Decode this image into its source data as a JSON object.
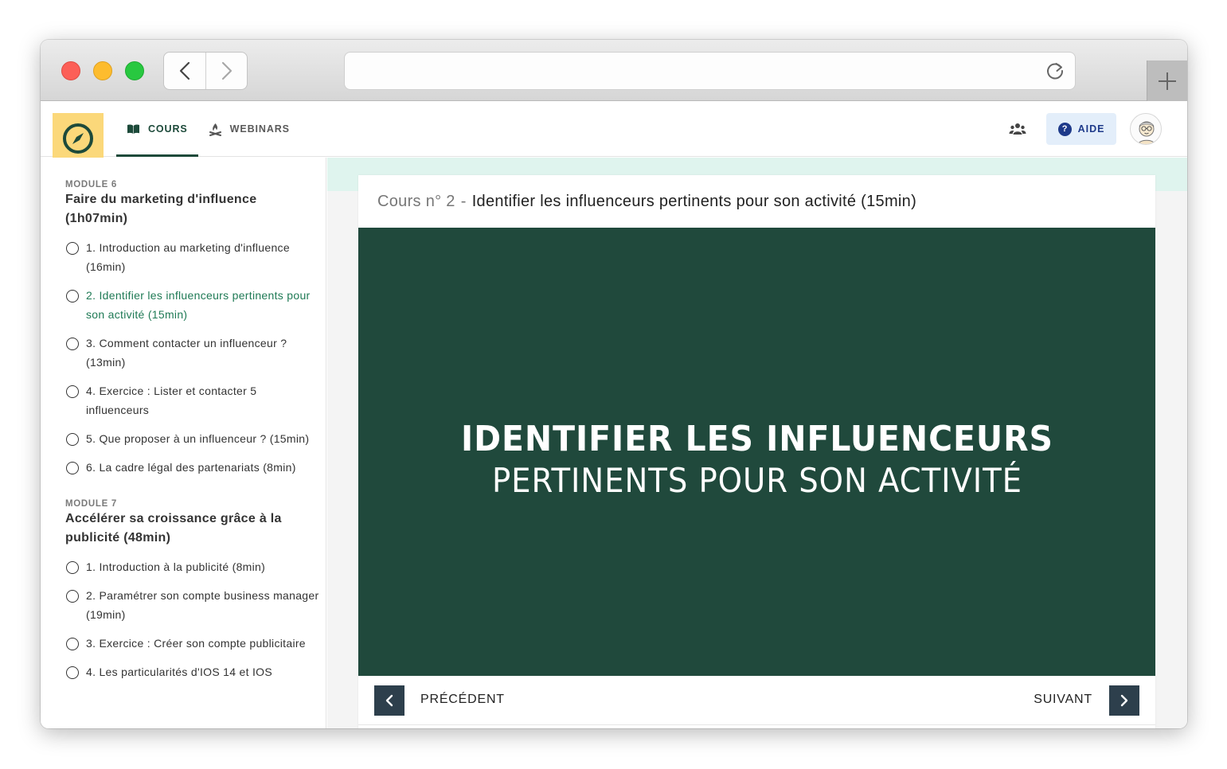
{
  "browser": {
    "url": "",
    "icons": {
      "back": "chevron-left-icon",
      "forward": "chevron-right-icon",
      "reload": "reload-icon",
      "new_tab": "plus-icon"
    }
  },
  "header": {
    "logo_icon": "compass-icon",
    "tabs": [
      {
        "label": "COURS",
        "icon": "book-icon",
        "active": true
      },
      {
        "label": "WEBINARS",
        "icon": "campfire-icon",
        "active": false
      }
    ],
    "team_icon": "team-icon",
    "help_label": "AIDE",
    "help_icon_glyph": "?",
    "avatar_icon": "avatar-icon"
  },
  "sidebar": {
    "modules": [
      {
        "label": "MODULE 6",
        "title": "Faire du marketing d'influence (1h07min)",
        "lessons": [
          {
            "text": "1. Introduction au marketing d'influence (16min)",
            "active": false
          },
          {
            "text": "2. Identifier les influenceurs pertinents pour son activité (15min)",
            "active": true
          },
          {
            "text": "3. Comment contacter un influenceur ? (13min)",
            "active": false
          },
          {
            "text": "4. Exercice : Lister et contacter 5 influenceurs",
            "active": false
          },
          {
            "text": "5. Que proposer à un influenceur ? (15min)",
            "active": false
          },
          {
            "text": "6. La cadre légal des partenariats (8min)",
            "active": false
          }
        ]
      },
      {
        "label": "MODULE 7",
        "title": "Accélérer sa croissance grâce à la publicité (48min)",
        "lessons": [
          {
            "text": "1. Introduction à la publicité (8min)",
            "active": false
          },
          {
            "text": "2. Paramétrer son compte business manager (19min)",
            "active": false
          },
          {
            "text": "3. Exercice : Créer son compte publicitaire",
            "active": false
          },
          {
            "text": "4. Les particularités d'IOS 14 et IOS",
            "active": false
          }
        ]
      }
    ]
  },
  "main": {
    "course_number": "Cours n° 2",
    "separator": "-",
    "course_title": "Identifier les influenceurs pertinents pour son activité (15min)",
    "video": {
      "line1": "IDENTIFIER LES INFLUENCEURS",
      "line2": "PERTINENTS POUR SON ACTIVITÉ",
      "background": "#20493c"
    },
    "pager": {
      "prev_label": "PRÉCÉDENT",
      "next_label": "SUIVANT"
    }
  },
  "colors": {
    "brand_dark_green": "#1d4a3a",
    "active_lesson_green": "#1f7a55",
    "logo_yellow": "#fbd87a",
    "help_bg": "#e3eefa",
    "help_text": "#1e3a8a",
    "pager_button": "#2d3f4c"
  }
}
